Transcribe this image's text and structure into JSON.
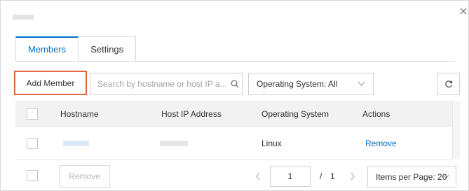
{
  "dialog": {
    "close_icon": "close-icon"
  },
  "tabs": [
    {
      "label": "Members",
      "active": true
    },
    {
      "label": "Settings",
      "active": false
    }
  ],
  "toolbar": {
    "add_member_label": "Add Member",
    "search_placeholder": "Search by hostname or host IP a...",
    "search_icon": "search-icon",
    "os_filter_label": "Operating System: All",
    "refresh_icon": "refresh-icon"
  },
  "table": {
    "columns": [
      "Hostname",
      "Host IP Address",
      "Operating System",
      "Actions"
    ],
    "rows": [
      {
        "operating_system": "Linux",
        "action": "Remove"
      }
    ]
  },
  "footer": {
    "remove_label": "Remove",
    "page_current": "1",
    "page_separator": "/",
    "page_total": "1",
    "per_page_label": "Items per Page: 20"
  },
  "colors": {
    "accent": "#0070cc",
    "highlight_border": "#e06640",
    "header_bg": "#f2f2f2"
  }
}
